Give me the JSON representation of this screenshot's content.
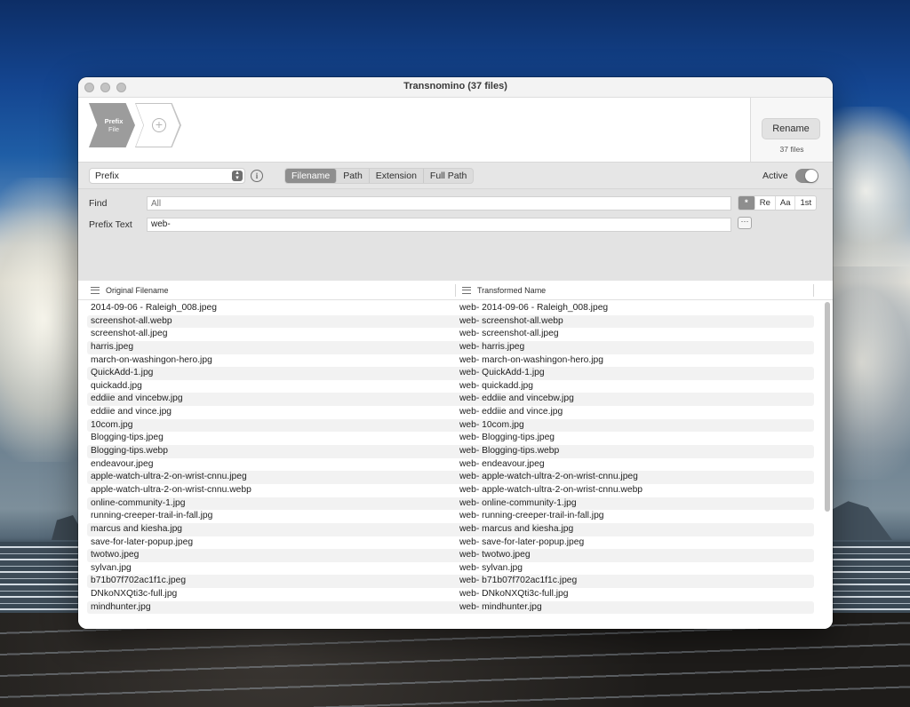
{
  "window": {
    "title": "Transnomino (37 files)"
  },
  "chain": {
    "step_title": "Prefix",
    "step_subtitle": "File",
    "add_icon": "plus-circle-icon"
  },
  "rename": {
    "button_label": "Rename",
    "files_count": "37 files"
  },
  "options": {
    "rule_select_value": "Prefix",
    "info_icon": "info-icon",
    "scope_tabs": [
      {
        "label": "Filename",
        "selected": true
      },
      {
        "label": "Path",
        "selected": false
      },
      {
        "label": "Extension",
        "selected": false
      },
      {
        "label": "Full Path",
        "selected": false
      }
    ],
    "active_label": "Active",
    "active_on": true
  },
  "settings": {
    "find_label": "Find",
    "find_placeholder": "All",
    "find_value": "",
    "find_options": [
      {
        "label": "*",
        "selected": true
      },
      {
        "label": "Re",
        "selected": false
      },
      {
        "label": "Aa",
        "selected": false
      },
      {
        "label": "1st",
        "selected": false
      }
    ],
    "prefix_label": "Prefix Text",
    "prefix_value": "web-",
    "more_button": "···"
  },
  "table": {
    "columns": [
      {
        "label": "Original Filename",
        "icon": "hamburger-icon"
      },
      {
        "label": "Transformed Name",
        "icon": "hamburger-icon"
      }
    ],
    "rows": [
      [
        "2014-09-06 - Raleigh_008.jpeg",
        "web- 2014-09-06 - Raleigh_008.jpeg"
      ],
      [
        "screenshot-all.webp",
        "web- screenshot-all.webp"
      ],
      [
        "screenshot-all.jpeg",
        "web- screenshot-all.jpeg"
      ],
      [
        "harris.jpeg",
        "web- harris.jpeg"
      ],
      [
        "march-on-washingon-hero.jpg",
        "web- march-on-washingon-hero.jpg"
      ],
      [
        "QuickAdd-1.jpg",
        "web- QuickAdd-1.jpg"
      ],
      [
        "quickadd.jpg",
        "web- quickadd.jpg"
      ],
      [
        "eddiie and vincebw.jpg",
        "web- eddiie and vincebw.jpg"
      ],
      [
        "eddiie and vince.jpg",
        "web- eddiie and vince.jpg"
      ],
      [
        "10com.jpg",
        "web- 10com.jpg"
      ],
      [
        "Blogging-tips.jpeg",
        "web- Blogging-tips.jpeg"
      ],
      [
        "Blogging-tips.webp",
        "web- Blogging-tips.webp"
      ],
      [
        "endeavour.jpeg",
        "web- endeavour.jpeg"
      ],
      [
        "apple-watch-ultra-2-on-wrist-cnnu.jpeg",
        "web- apple-watch-ultra-2-on-wrist-cnnu.jpeg"
      ],
      [
        "apple-watch-ultra-2-on-wrist-cnnu.webp",
        "web- apple-watch-ultra-2-on-wrist-cnnu.webp"
      ],
      [
        "online-community-1.jpg",
        "web- online-community-1.jpg"
      ],
      [
        "running-creeper-trail-in-fall.jpg",
        "web- running-creeper-trail-in-fall.jpg"
      ],
      [
        "marcus and kiesha.jpg",
        "web- marcus and kiesha.jpg"
      ],
      [
        "save-for-later-popup.jpeg",
        "web- save-for-later-popup.jpeg"
      ],
      [
        "twotwo.jpeg",
        "web- twotwo.jpeg"
      ],
      [
        "sylvan.jpg",
        "web- sylvan.jpg"
      ],
      [
        "b71b07f702ac1f1c.jpeg",
        "web- b71b07f702ac1f1c.jpeg"
      ],
      [
        "DNkoNXQti3c-full.jpg",
        "web- DNkoNXQti3c-full.jpg"
      ],
      [
        "mindhunter.jpg",
        "web- mindhunter.jpg"
      ]
    ]
  }
}
